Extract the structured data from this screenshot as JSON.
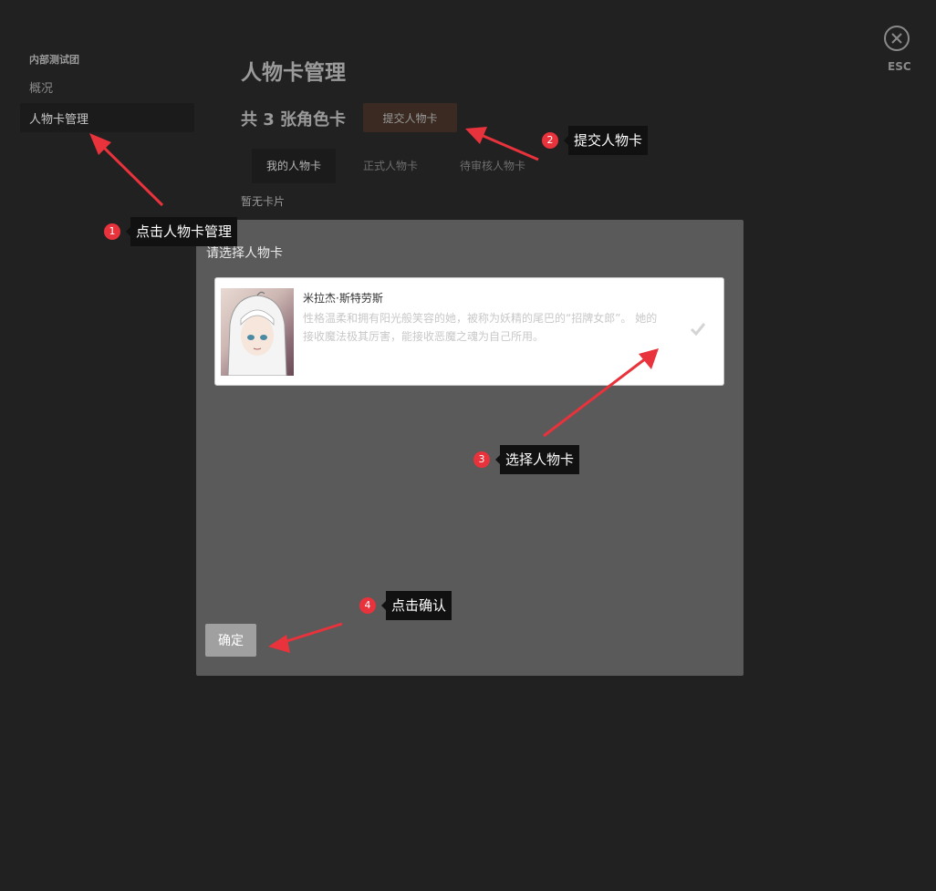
{
  "sidebar": {
    "group_title": "内部测试团",
    "items": [
      {
        "label": "概况"
      },
      {
        "label": "人物卡管理"
      }
    ]
  },
  "main": {
    "title": "人物卡管理",
    "count_text": "共 3 张角色卡",
    "submit_label": "提交人物卡",
    "tabs": [
      {
        "label": "我的人物卡",
        "active": true
      },
      {
        "label": "正式人物卡"
      },
      {
        "label": "待审核人物卡"
      }
    ],
    "empty_text": "暂无卡片"
  },
  "close": {
    "label": "ESC"
  },
  "modal": {
    "title": "请选择人物卡",
    "card": {
      "name": "米拉杰·斯特劳斯",
      "description": "性格温柔和拥有阳光般笑容的她，被称为妖精的尾巴的“招牌女郎”。 她的接收魔法极其厉害，能接收恶魔之魂为自己所用。"
    },
    "confirm_label": "确定"
  },
  "annotations": [
    {
      "num": "1",
      "text": "点击人物卡管理"
    },
    {
      "num": "2",
      "text": "提交人物卡"
    },
    {
      "num": "3",
      "text": "选择人物卡"
    },
    {
      "num": "4",
      "text": "点击确认"
    }
  ],
  "colors": {
    "background": "#212121",
    "modal": "#5a5a5a",
    "annotation_badge": "#e8323c",
    "arrow": "#e8323c"
  }
}
